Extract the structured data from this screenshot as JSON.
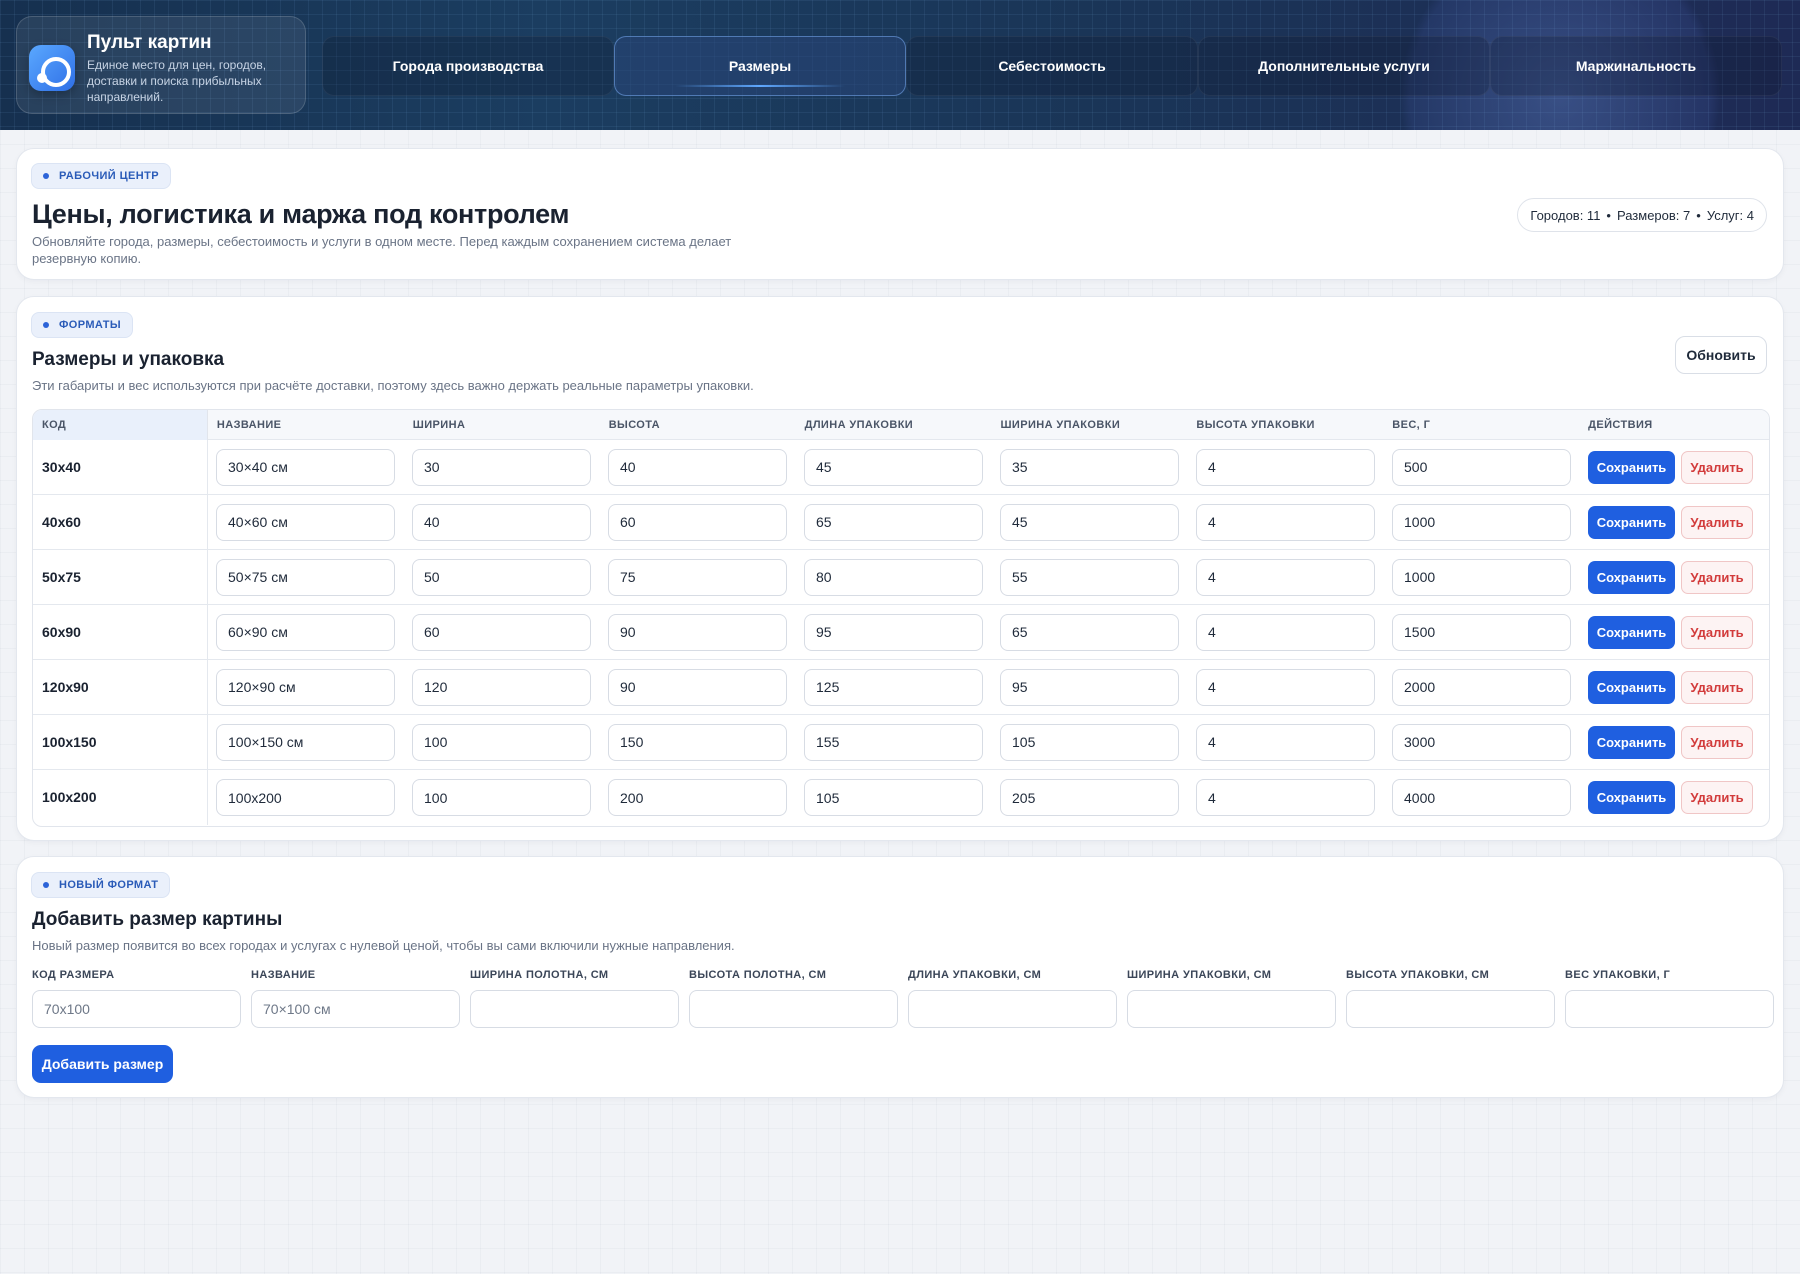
{
  "brand": {
    "title": "Пульт картин",
    "subtitle": "Единое место для цен, городов, доставки и поиска прибыльных направлений."
  },
  "nav": {
    "tabs": [
      {
        "label": "Города производства",
        "active": false
      },
      {
        "label": "Размеры",
        "active": true
      },
      {
        "label": "Себестоимость",
        "active": false
      },
      {
        "label": "Дополнительные услуги",
        "active": false
      },
      {
        "label": "Маржинальность",
        "active": false
      }
    ]
  },
  "overview": {
    "badge": "РАБОЧИЙ ЦЕНТР",
    "title": "Цены, логистика и маржа под контролем",
    "description": "Обновляйте города, размеры, себестоимость и услуги в одном месте. Перед каждым сохранением система делает резервную копию.",
    "stats": {
      "cities": "Городов: 11",
      "sizes": "Размеров: 7",
      "services": "Услуг: 4",
      "separator": "•"
    }
  },
  "formats": {
    "badge": "ФОРМАТЫ",
    "title": "Размеры и упаковка",
    "description": "Эти габариты и вес используются при расчёте доставки, поэтому здесь важно держать реальные параметры упаковки.",
    "refresh_label": "Обновить",
    "columns": [
      "КОД",
      "НАЗВАНИЕ",
      "ШИРИНА",
      "ВЫСОТА",
      "ДЛИНА УПАКОВКИ",
      "ШИРИНА УПАКОВКИ",
      "ВЫСОТА УПАКОВКИ",
      "ВЕС, Г",
      "ДЕЙСТВИЯ"
    ],
    "save_label": "Сохранить",
    "delete_label": "Удалить",
    "rows": [
      {
        "code": "30x40",
        "name": "30×40 см",
        "width": "30",
        "height": "40",
        "pack_length": "45",
        "pack_width": "35",
        "pack_height": "4",
        "weight": "500"
      },
      {
        "code": "40x60",
        "name": "40×60 см",
        "width": "40",
        "height": "60",
        "pack_length": "65",
        "pack_width": "45",
        "pack_height": "4",
        "weight": "1000"
      },
      {
        "code": "50x75",
        "name": "50×75 см",
        "width": "50",
        "height": "75",
        "pack_length": "80",
        "pack_width": "55",
        "pack_height": "4",
        "weight": "1000"
      },
      {
        "code": "60x90",
        "name": "60×90 см",
        "width": "60",
        "height": "90",
        "pack_length": "95",
        "pack_width": "65",
        "pack_height": "4",
        "weight": "1500"
      },
      {
        "code": "120x90",
        "name": "120×90 см",
        "width": "120",
        "height": "90",
        "pack_length": "125",
        "pack_width": "95",
        "pack_height": "4",
        "weight": "2000"
      },
      {
        "code": "100x150",
        "name": "100×150 см",
        "width": "100",
        "height": "150",
        "pack_length": "155",
        "pack_width": "105",
        "pack_height": "4",
        "weight": "3000"
      },
      {
        "code": "100x200",
        "name": "100x200",
        "width": "100",
        "height": "200",
        "pack_length": "105",
        "pack_width": "205",
        "pack_height": "4",
        "weight": "4000"
      }
    ]
  },
  "new_format": {
    "badge": "НОВЫЙ ФОРМАТ",
    "title": "Добавить размер картины",
    "description": "Новый размер появится во всех городах и услугах с нулевой ценой, чтобы вы сами включили нужные направления.",
    "fields": [
      {
        "label": "КОД РАЗМЕРА",
        "placeholder": "70x100"
      },
      {
        "label": "НАЗВАНИЕ",
        "placeholder": "70×100 см"
      },
      {
        "label": "ШИРИНА ПОЛОТНА, СМ",
        "placeholder": ""
      },
      {
        "label": "ВЫСОТА ПОЛОТНА, СМ",
        "placeholder": ""
      },
      {
        "label": "ДЛИНА УПАКОВКИ, СМ",
        "placeholder": ""
      },
      {
        "label": "ШИРИНА УПАКОВКИ, СМ",
        "placeholder": ""
      },
      {
        "label": "ВЫСОТА УПАКОВКИ, СМ",
        "placeholder": ""
      },
      {
        "label": "ВЕС УПАКОВКИ, Г",
        "placeholder": ""
      }
    ],
    "add_label": "Добавить размер"
  }
}
